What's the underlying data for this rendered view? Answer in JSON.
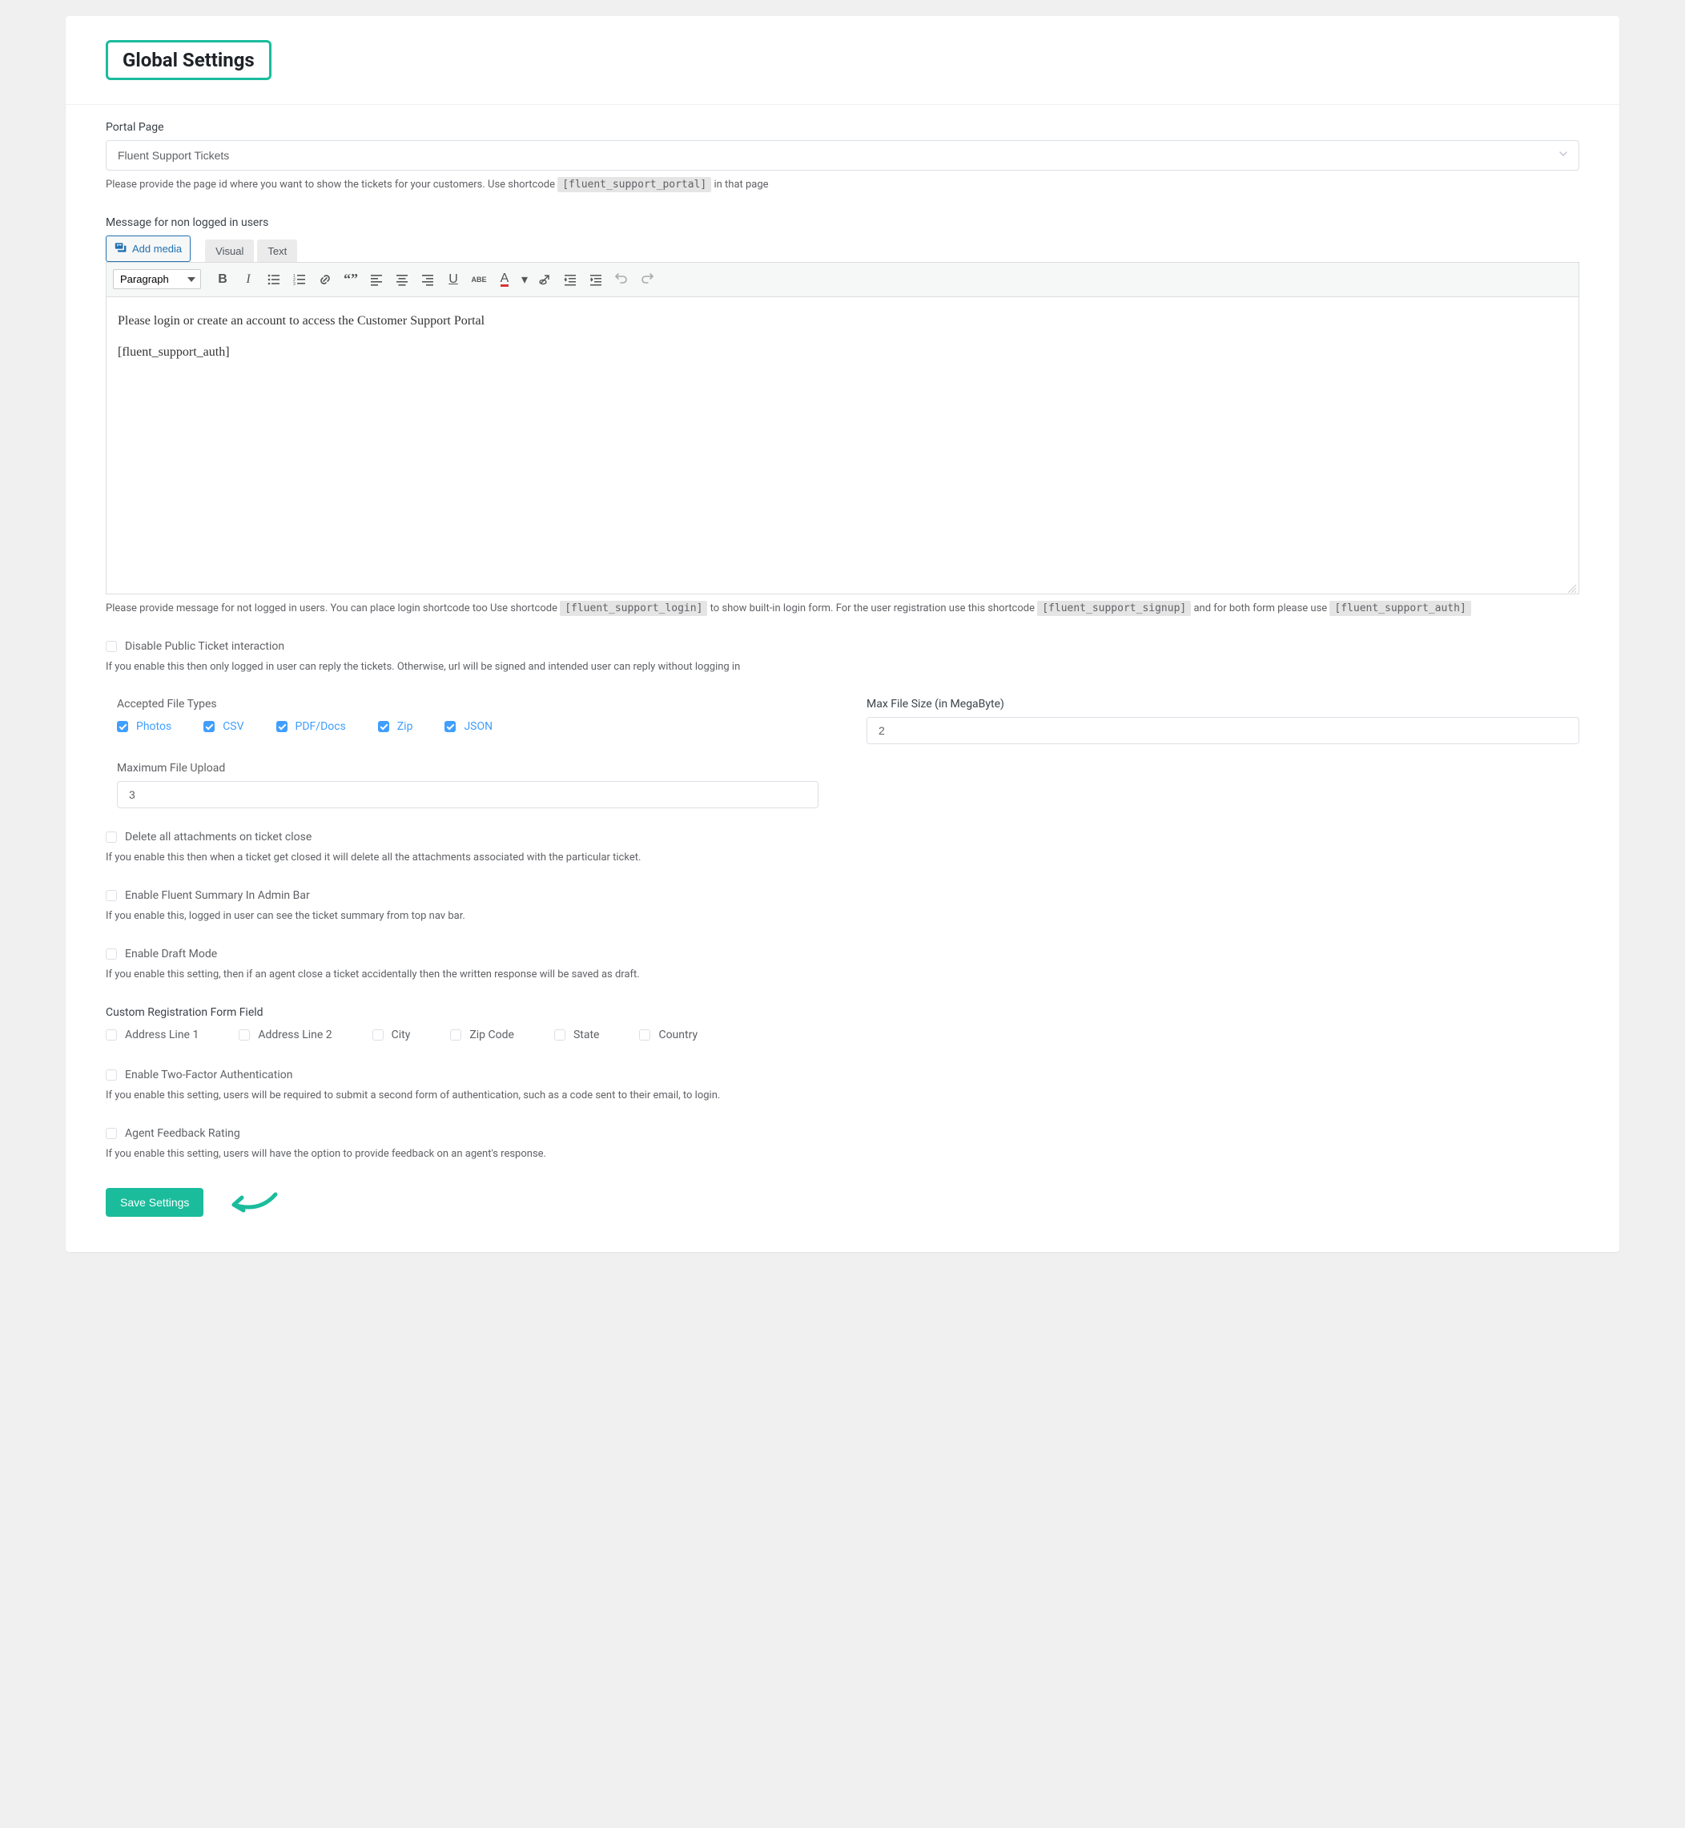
{
  "page_title": "Global Settings",
  "portal_page": {
    "label": "Portal Page",
    "value": "Fluent Support Tickets",
    "help_prefix": "Please provide the page id where you want to show the tickets for your customers. Use shortcode ",
    "help_code": "[fluent_support_portal]",
    "help_suffix": " in that page"
  },
  "editor": {
    "label": "Message for non logged in users",
    "add_media": "Add media",
    "tab_visual": "Visual",
    "tab_text": "Text",
    "format_value": "Paragraph",
    "body_line1": "Please login or create an account to access the Customer Support Portal",
    "body_line2": "[fluent_support_auth]",
    "help_prefix": "Please provide message for not logged in users. You can place login shortcode too Use shortcode ",
    "help_code1": "[fluent_support_login]",
    "help_mid1": " to show built-in login form. For the user registration use this shortcode ",
    "help_code2": "[fluent_support_signup]",
    "help_mid2": " and for both form please use ",
    "help_code3": "[fluent_support_auth]"
  },
  "disable_public": {
    "label": "Disable Public Ticket interaction",
    "help": "If you enable this then only logged in user can reply the tickets. Otherwise, url will be signed and intended user can reply without logging in"
  },
  "file_types": {
    "label": "Accepted File Types",
    "items": [
      "Photos",
      "CSV",
      "PDF/Docs",
      "Zip",
      "JSON"
    ]
  },
  "max_file_size": {
    "label": "Max File Size (in MegaByte)",
    "value": "2"
  },
  "max_upload": {
    "label": "Maximum File Upload",
    "value": "3"
  },
  "delete_attachments": {
    "label": "Delete all attachments on ticket close",
    "help": "If you enable this then when a ticket get closed it will delete all the attachments associated with the particular ticket."
  },
  "admin_bar": {
    "label": "Enable Fluent Summary In Admin Bar",
    "help": "If you enable this, logged in user can see the ticket summary from top nav bar."
  },
  "draft_mode": {
    "label": "Enable Draft Mode",
    "help": "If you enable this setting, then if an agent close a ticket accidentally then the written response will be saved as draft."
  },
  "custom_reg": {
    "label": "Custom Registration Form Field",
    "fields": [
      "Address Line 1",
      "Address Line 2",
      "City",
      "Zip Code",
      "State",
      "Country"
    ]
  },
  "twofa": {
    "label": "Enable Two-Factor Authentication",
    "help": "If you enable this setting, users will be required to submit a second form of authentication, such as a code sent to their email, to login."
  },
  "feedback": {
    "label": "Agent Feedback Rating",
    "help": "If you enable this setting, users will have the option to provide feedback on an agent's response."
  },
  "save_button": "Save Settings"
}
